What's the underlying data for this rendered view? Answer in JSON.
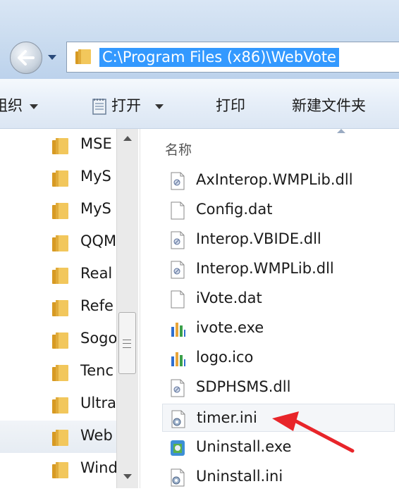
{
  "window": {
    "address_path": "C:\\Program Files (x86)\\WebVote"
  },
  "toolbar": {
    "organize_label": "组织",
    "open_label": "打开",
    "print_label": "打印",
    "new_folder_label": "新建文件夹"
  },
  "nav": {
    "items": [
      {
        "label": "MSE",
        "selected": false
      },
      {
        "label": "MyS",
        "selected": false
      },
      {
        "label": "MyS",
        "selected": false
      },
      {
        "label": "QQM",
        "selected": false
      },
      {
        "label": "Real",
        "selected": false
      },
      {
        "label": "Refe",
        "selected": false
      },
      {
        "label": "Sogo",
        "selected": false
      },
      {
        "label": "Tenc",
        "selected": false
      },
      {
        "label": "Ultra",
        "selected": false
      },
      {
        "label": "Web",
        "selected": true
      },
      {
        "label": "Wind",
        "selected": false
      }
    ]
  },
  "file_list": {
    "column_name": "名称",
    "files": [
      {
        "name": "AxInterop.WMPLib.dll",
        "icon": "dll-icon"
      },
      {
        "name": "Config.dat",
        "icon": "blank-file-icon"
      },
      {
        "name": "Interop.VBIDE.dll",
        "icon": "dll-icon"
      },
      {
        "name": "Interop.WMPLib.dll",
        "icon": "dll-icon"
      },
      {
        "name": "iVote.dat",
        "icon": "blank-file-icon"
      },
      {
        "name": "ivote.exe",
        "icon": "chart-exe-icon"
      },
      {
        "name": "logo.ico",
        "icon": "chart-exe-icon"
      },
      {
        "name": "SDPHSMS.dll",
        "icon": "dll-icon"
      },
      {
        "name": "timer.ini",
        "icon": "ini-settings-icon",
        "highlighted": true
      },
      {
        "name": "Uninstall.exe",
        "icon": "uninstall-exe-icon"
      },
      {
        "name": "Uninstall.ini",
        "icon": "ini-settings-icon"
      }
    ]
  },
  "colors": {
    "selection": "#3399ff",
    "folder": "#e8b84a",
    "annotation_arrow": "#e8252a"
  }
}
